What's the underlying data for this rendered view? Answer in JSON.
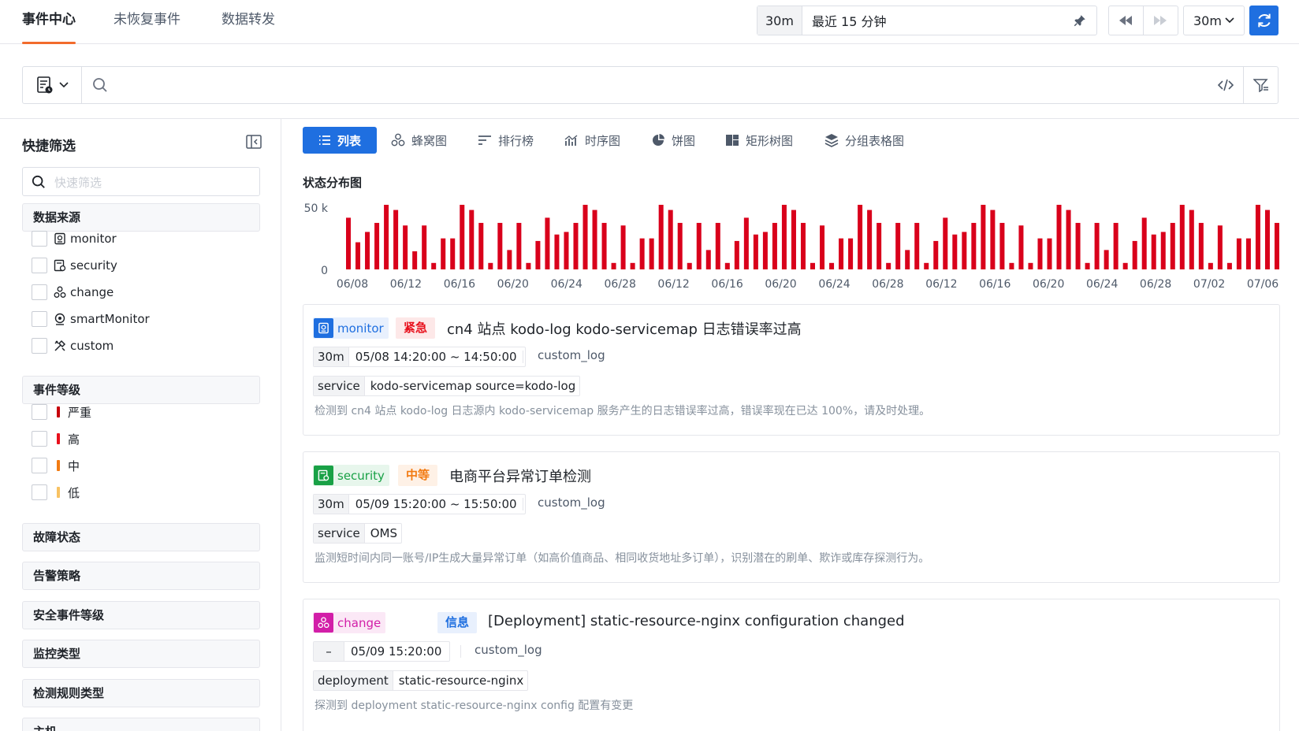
{
  "top_tabs": [
    {
      "label": "事件中心",
      "active": true
    },
    {
      "label": "未恢复事件",
      "active": false
    },
    {
      "label": "数据转发",
      "active": false
    }
  ],
  "time_range": {
    "badge": "30m",
    "label": "最近 15 分钟"
  },
  "refresh_interval": "30m",
  "sidebar": {
    "title": "快捷筛选",
    "search_placeholder": "快速筛选",
    "sections": [
      "数据来源",
      "事件等级",
      "故障状态",
      "告警策略",
      "安全事件等级",
      "监控类型",
      "检测规则类型",
      "主机"
    ],
    "sources": [
      {
        "label": "monitor",
        "icon": "monitor-icon"
      },
      {
        "label": "security",
        "icon": "security-icon"
      },
      {
        "label": "change",
        "icon": "change-icon"
      },
      {
        "label": "smartMonitor",
        "icon": "smart-monitor-icon"
      },
      {
        "label": "custom",
        "icon": "custom-icon"
      }
    ],
    "levels": [
      {
        "label": "严重",
        "color": "#c7000b"
      },
      {
        "label": "高",
        "color": "#e8101c"
      },
      {
        "label": "中",
        "color": "#f27b12"
      },
      {
        "label": "低",
        "color": "#f8c262"
      }
    ]
  },
  "view_tabs": [
    {
      "label": "列表",
      "icon": "list-icon",
      "active": true
    },
    {
      "label": "蜂窝图",
      "icon": "hive-icon",
      "active": false
    },
    {
      "label": "排行榜",
      "icon": "rank-icon",
      "active": false
    },
    {
      "label": "时序图",
      "icon": "timeseries-icon",
      "active": false
    },
    {
      "label": "饼图",
      "icon": "pie-icon",
      "active": false
    },
    {
      "label": "矩形树图",
      "icon": "treemap-icon",
      "active": false
    },
    {
      "label": "分组表格图",
      "icon": "group-table-icon",
      "active": false
    }
  ],
  "chart_title": "状态分布图",
  "chart_data": {
    "type": "bar",
    "ylabel": "",
    "xlabel": "",
    "y_ticks": [
      "50 k",
      "0"
    ],
    "ylim": [
      0,
      50
    ],
    "x_ticks": [
      "06/08",
      "06/12",
      "06/16",
      "06/20",
      "06/24",
      "06/28",
      "06/12",
      "06/16",
      "06/20",
      "06/24",
      "06/28",
      "06/12",
      "06/16",
      "06/20",
      "06/24",
      "06/28",
      "07/02",
      "07/06"
    ],
    "bar_color": "#d9001b",
    "values": [
      40,
      21,
      29,
      36,
      50,
      46,
      34,
      14,
      34,
      5,
      24,
      24,
      50,
      46,
      36,
      5,
      36,
      15,
      36,
      5,
      22,
      40,
      27,
      29,
      36,
      50,
      46,
      36,
      5,
      34,
      5,
      24,
      24,
      50,
      46,
      36,
      5,
      36,
      15,
      36,
      5,
      22,
      40,
      27,
      29,
      36,
      50,
      46,
      36,
      5,
      34,
      5,
      24,
      24,
      50,
      46,
      36,
      5,
      36,
      15,
      36,
      5,
      22,
      40,
      27,
      29,
      36,
      50,
      46,
      36,
      5,
      34,
      5,
      24,
      24,
      50,
      46,
      36,
      5,
      36,
      15,
      36,
      5,
      22,
      40,
      27,
      29,
      36,
      50,
      46,
      36,
      5,
      34,
      5,
      24,
      24,
      50,
      46,
      36
    ]
  },
  "events": [
    {
      "source": "monitor",
      "source_color": "#1f6fe0",
      "source_bg": "#e8f0fd",
      "level": "紧急",
      "level_color": "#e8101c",
      "level_bg": "#fde8e8",
      "title": "cn4 站点 kodo-log kodo-servicemap 日志错误率过高",
      "duration": "30m",
      "time": "05/08 14:20:00 ~ 14:50:00",
      "log": "custom_log",
      "tag_key": "service",
      "tag_value": "kodo-servicemap source=kodo-log",
      "desc": "检测到 cn4 站点 kodo-log 日志源内 kodo-servicemap 服务产生的日志错误率过高，错误率现在已达 100%，请及时处理。"
    },
    {
      "source": "security",
      "source_color": "#19a146",
      "source_bg": "#e7f6ec",
      "level": "中等",
      "level_color": "#f27b12",
      "level_bg": "#fef1e6",
      "title": "电商平台异常订单检测",
      "duration": "30m",
      "time": "05/09 15:20:00 ~ 15:50:00",
      "log": "custom_log",
      "tag_key": "service",
      "tag_value": "OMS",
      "desc": "监测短时间内同一账号/IP生成大量异常订单（如高价值商品、相同收货地址多订单），识别潜在的刷单、欺诈或库存探测行为。"
    },
    {
      "source": "change",
      "source_color": "#d21ea8",
      "source_bg": "#fbe8f6",
      "level": "信息",
      "level_color": "#1f6fe0",
      "level_bg": "#e8f0fd",
      "title": "[Deployment] static-resource-nginx configuration changed",
      "duration": "–",
      "time": "05/09 15:20:00",
      "log": "custom_log",
      "tag_key": "deployment",
      "tag_value": "static-resource-nginx",
      "desc": "探测到 deployment static-resource-nginx config 配置有变更"
    }
  ]
}
